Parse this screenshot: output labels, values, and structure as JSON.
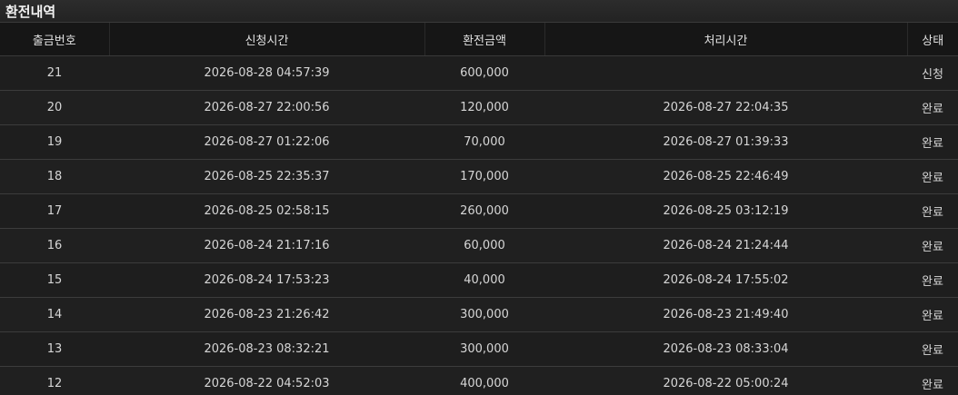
{
  "title": "환전내역",
  "columns": [
    "출금번호",
    "신청시간",
    "환전금액",
    "처리시간",
    "상태"
  ],
  "rows": [
    {
      "no": "21",
      "requested": "2026-08-28 04:57:39",
      "amount": "600,000",
      "processed": "",
      "status": "신청"
    },
    {
      "no": "20",
      "requested": "2026-08-27 22:00:56",
      "amount": "120,000",
      "processed": "2026-08-27 22:04:35",
      "status": "완료"
    },
    {
      "no": "19",
      "requested": "2026-08-27 01:22:06",
      "amount": "70,000",
      "processed": "2026-08-27 01:39:33",
      "status": "완료"
    },
    {
      "no": "18",
      "requested": "2026-08-25 22:35:37",
      "amount": "170,000",
      "processed": "2026-08-25 22:46:49",
      "status": "완료"
    },
    {
      "no": "17",
      "requested": "2026-08-25 02:58:15",
      "amount": "260,000",
      "processed": "2026-08-25 03:12:19",
      "status": "완료"
    },
    {
      "no": "16",
      "requested": "2026-08-24 21:17:16",
      "amount": "60,000",
      "processed": "2026-08-24 21:24:44",
      "status": "완료"
    },
    {
      "no": "15",
      "requested": "2026-08-24 17:53:23",
      "amount": "40,000",
      "processed": "2026-08-24 17:55:02",
      "status": "완료"
    },
    {
      "no": "14",
      "requested": "2026-08-23 21:26:42",
      "amount": "300,000",
      "processed": "2026-08-23 21:49:40",
      "status": "완료"
    },
    {
      "no": "13",
      "requested": "2026-08-23 08:32:21",
      "amount": "300,000",
      "processed": "2026-08-23 08:33:04",
      "status": "완료"
    },
    {
      "no": "12",
      "requested": "2026-08-22 04:52:03",
      "amount": "400,000",
      "processed": "2026-08-22 05:00:24",
      "status": "완료"
    }
  ]
}
